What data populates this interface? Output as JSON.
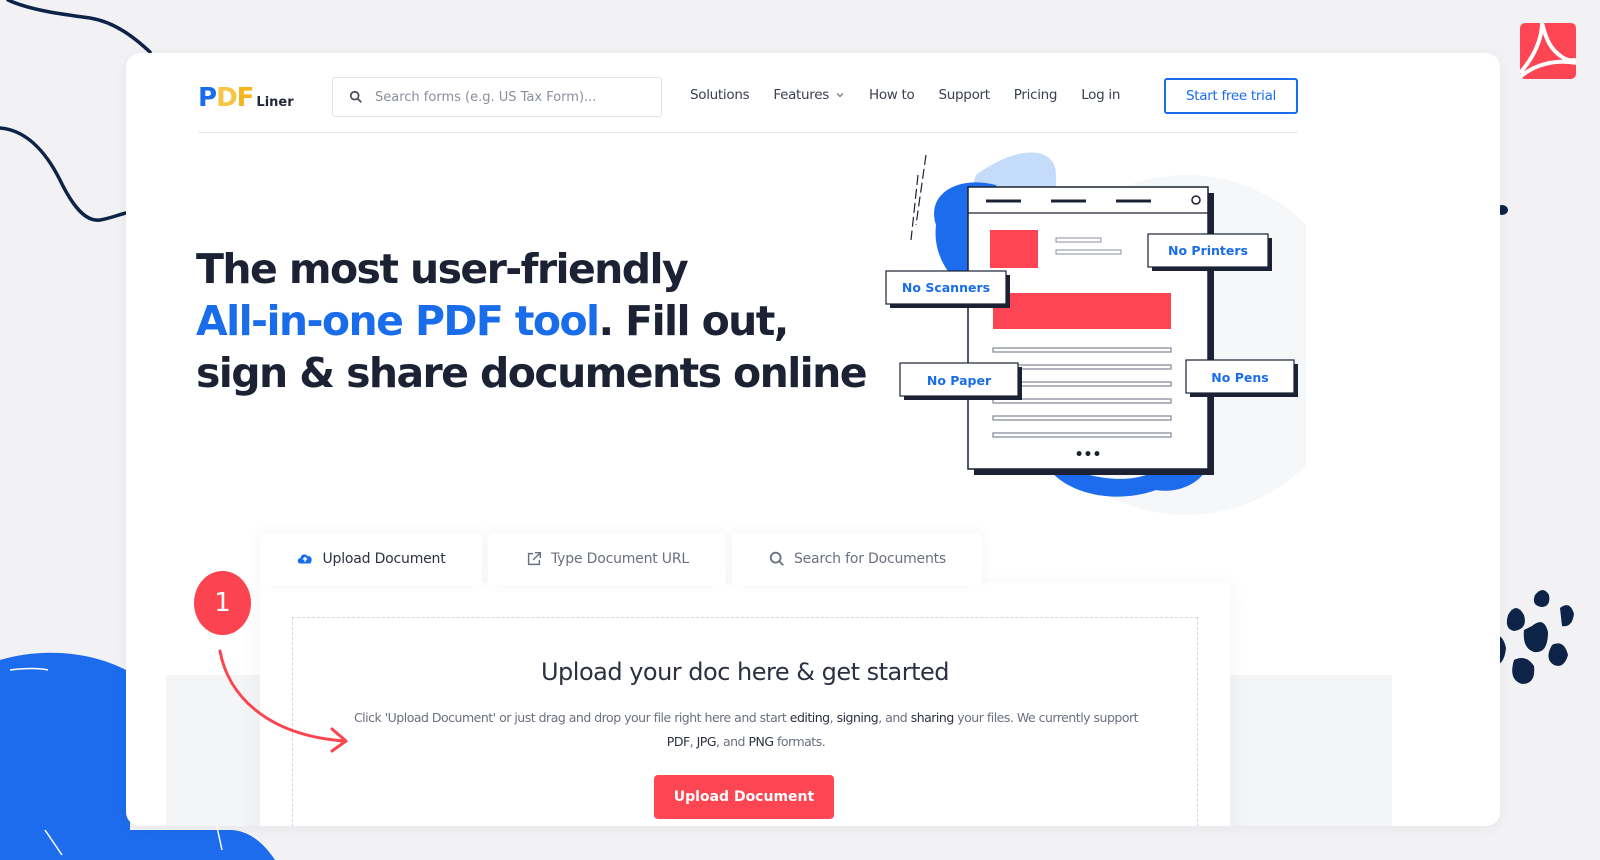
{
  "colors": {
    "brand_blue": "#1a6dea",
    "accent_red": "#fd4553",
    "navy": "#0d2347",
    "background": "#f2f2f4"
  },
  "header": {
    "logo": {
      "pdf_text": "PDF",
      "liner_text": "Liner"
    },
    "search": {
      "icon": "search-icon",
      "placeholder": "Search forms (e.g. US Tax Form)...",
      "value": ""
    },
    "nav": [
      {
        "label": "Solutions"
      },
      {
        "label": "Features",
        "icon": "chevron-down-icon"
      },
      {
        "label": "How to"
      },
      {
        "label": "Support"
      },
      {
        "label": "Pricing"
      },
      {
        "label": "Log in"
      }
    ],
    "cta_label": "Start free trial"
  },
  "hero": {
    "line1": "The most user-friendly",
    "line2_accent": "All-in-one PDF tool",
    "line2_rest": ". Fill out,",
    "line3": "sign & share documents online"
  },
  "illustration": {
    "badges": [
      "No Printers",
      "No Scanners",
      "No Paper",
      "No Pens"
    ],
    "more_dots": "•••"
  },
  "tabs": [
    {
      "label": "Upload Document",
      "icon": "cloud-upload-icon",
      "active": true
    },
    {
      "label": "Type Document URL",
      "icon": "external-link-icon",
      "active": false
    },
    {
      "label": "Search for Documents",
      "icon": "search-icon",
      "active": false
    }
  ],
  "upload": {
    "title": "Upload your doc here & get started",
    "desc_part1": "Click 'Upload Document' or just drag and drop your file right here and start ",
    "desc_b1": "editing",
    "desc_sep1": ", ",
    "desc_b2": "signing",
    "desc_sep2": ", and ",
    "desc_b3": "sharing",
    "desc_part2": " your files. We currently support ",
    "desc_b4": "PDF",
    "desc_sep3": ", ",
    "desc_b5": "JPG",
    "desc_sep4": ", and ",
    "desc_b6": "PNG",
    "desc_part3": " formats.",
    "button_label": "Upload Document"
  },
  "annotation": {
    "step_number": "1"
  },
  "corner_icon": "adobe-acrobat-icon"
}
